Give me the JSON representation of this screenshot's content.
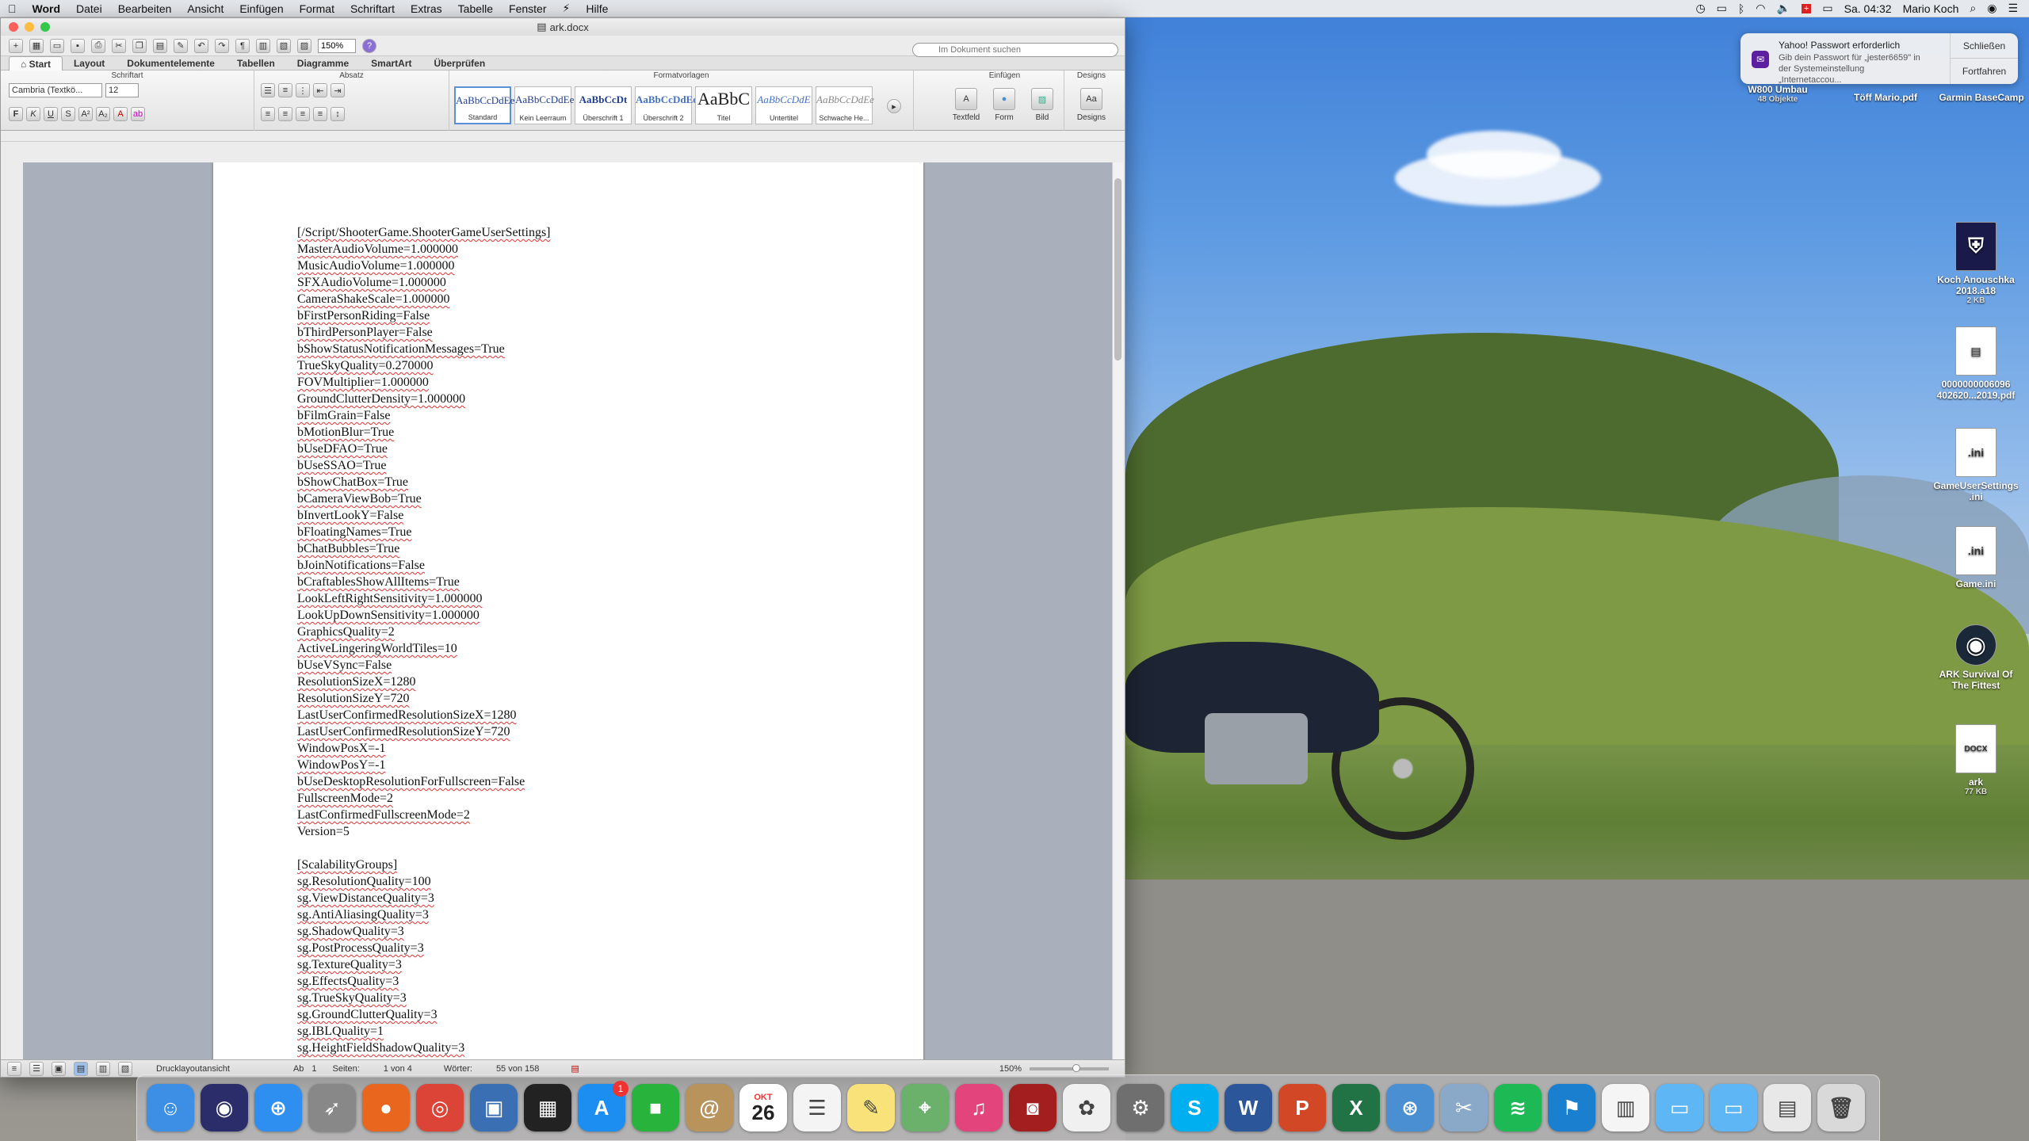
{
  "menubar": {
    "app": "Word",
    "items": [
      "Datei",
      "Bearbeiten",
      "Ansicht",
      "Einfügen",
      "Format",
      "Schriftart",
      "Extras",
      "Tabelle",
      "Fenster",
      "Hilfe"
    ],
    "clock": "Sa. 04:32",
    "user": "Mario Koch"
  },
  "window": {
    "title": "ark.docx",
    "zoom": "150%",
    "search_placeholder": "Im Dokument suchen",
    "tabs": [
      "Start",
      "Layout",
      "Dokumentelemente",
      "Tabellen",
      "Diagramme",
      "SmartArt",
      "Überprüfen"
    ],
    "groups": {
      "font": "Schriftart",
      "paragraph": "Absatz",
      "styles": "Formatvorlagen",
      "insert": "Einfügen",
      "designs": "Designs"
    },
    "font_name": "Cambria (Textkö...",
    "font_size": "12",
    "styles": [
      {
        "preview": "AaBbCcDdEe",
        "name": "Standard"
      },
      {
        "preview": "AaBbCcDdEe",
        "name": "Kein Leerraum"
      },
      {
        "preview": "AaBbCcDt",
        "name": "Überschrift 1"
      },
      {
        "preview": "AaBbCcDdEe",
        "name": "Überschrift 2"
      },
      {
        "preview": "AaBbC",
        "name": "Titel"
      },
      {
        "preview": "AaBbCcDdE",
        "name": "Untertitel"
      },
      {
        "preview": "AaBbCcDdEe",
        "name": "Schwache He..."
      }
    ],
    "insert_items": [
      "Textfeld",
      "Form",
      "Bild"
    ],
    "designs_label": "Designs",
    "status": {
      "view": "Drucklayoutansicht",
      "section_label": "Ab",
      "section": "1",
      "pages_label": "Seiten:",
      "pages": "1 von 4",
      "words_label": "Wörter:",
      "words": "55 von 158",
      "zoom": "150%"
    }
  },
  "document_lines": [
    "[/Script/ShooterGame.ShooterGameUserSettings]",
    "MasterAudioVolume=1.000000",
    "MusicAudioVolume=1.000000",
    "SFXAudioVolume=1.000000",
    "CameraShakeScale=1.000000",
    "bFirstPersonRiding=False",
    "bThirdPersonPlayer=False",
    "bShowStatusNotificationMessages=True",
    "TrueSkyQuality=0.270000",
    "FOVMultiplier=1.000000",
    "GroundClutterDensity=1.000000",
    "bFilmGrain=False",
    "bMotionBlur=True",
    "bUseDFAO=True",
    "bUseSSAO=True",
    "bShowChatBox=True",
    "bCameraViewBob=True",
    "bInvertLookY=False",
    "bFloatingNames=True",
    "bChatBubbles=True",
    "bJoinNotifications=False",
    "bCraftablesShowAllItems=True",
    "LookLeftRightSensitivity=1.000000",
    "LookUpDownSensitivity=1.000000",
    "GraphicsQuality=2",
    "ActiveLingeringWorldTiles=10",
    "bUseVSync=False",
    "ResolutionSizeX=1280",
    "ResolutionSizeY=720",
    "LastUserConfirmedResolutionSizeX=1280",
    "LastUserConfirmedResolutionSizeY=720",
    "WindowPosX=-1",
    "WindowPosY=-1",
    "bUseDesktopResolutionForFullscreen=False",
    "FullscreenMode=2",
    "LastConfirmedFullscreenMode=2",
    "Version=5",
    "",
    "[ScalabilityGroups]",
    "sg.ResolutionQuality=100",
    "sg.ViewDistanceQuality=3",
    "sg.AntiAliasingQuality=3",
    "sg.ShadowQuality=3",
    "sg.PostProcessQuality=3",
    "sg.TextureQuality=3",
    "sg.EffectsQuality=3",
    "sg.TrueSkyQuality=3",
    "sg.GroundClutterQuality=3",
    "sg.IBLQuality=1",
    "sg.HeightFieldShadowQuality=3"
  ],
  "notification": {
    "title": "Yahoo! Passwort erforderlich",
    "body": "Gib dein Passwort für „jester6659\" in der Systemeinstellung „Internetaccou...",
    "close": "Schließen",
    "continue": "Fortfahren"
  },
  "desktop": {
    "top_labels": [
      {
        "name": "W800 Umbau",
        "sub": "48 Objekte"
      },
      {
        "name": "Töff Mario.pdf",
        "sub": ""
      },
      {
        "name": "Garmin BaseCamp",
        "sub": ""
      }
    ],
    "icons": [
      {
        "name": "Koch Anouschka 2018.a18",
        "sub": "2 KB",
        "glyph": "⛨"
      },
      {
        "name": "0000000006096 402620...2019.pdf",
        "sub": "",
        "glyph": "▤"
      },
      {
        "name": "GameUserSettings .ini",
        "sub": "",
        "glyph": ".ini"
      },
      {
        "name": "Game.ini",
        "sub": "",
        "glyph": ".ini"
      },
      {
        "name": "ARK Survival Of The Fittest",
        "sub": "",
        "glyph": "◉"
      },
      {
        "name": "ark",
        "sub": "77 KB",
        "glyph": "DOCX"
      }
    ]
  },
  "dock": {
    "calendar_month": "OKT",
    "calendar_day": "26",
    "appstore_badge": "1",
    "apps": [
      {
        "name": "Finder",
        "glyph": "☺",
        "color": "#3d8fe6"
      },
      {
        "name": "Siri",
        "glyph": "◉",
        "color": "#2b2d6b"
      },
      {
        "name": "Safari",
        "glyph": "⊕",
        "color": "#2f8ff0"
      },
      {
        "name": "Launchpad",
        "glyph": "➶",
        "color": "#888"
      },
      {
        "name": "Firefox",
        "glyph": "●",
        "color": "#e8661d"
      },
      {
        "name": "Chrome",
        "glyph": "◎",
        "color": "#db4437"
      },
      {
        "name": "Preview",
        "glyph": "▣",
        "color": "#3a6fb3"
      },
      {
        "name": "Photo Booth",
        "glyph": "▦",
        "color": "#222"
      },
      {
        "name": "App Store",
        "glyph": "A",
        "color": "#1c8ef2"
      },
      {
        "name": "FaceTime",
        "glyph": "■",
        "color": "#27b33c"
      },
      {
        "name": "Contacts",
        "glyph": "@",
        "color": "#b9935c"
      },
      {
        "name": "Calendar",
        "glyph": "",
        "color": "#ffffff"
      },
      {
        "name": "Reminders",
        "glyph": "☰",
        "color": "#f4f4f4"
      },
      {
        "name": "Notes",
        "glyph": "✎",
        "color": "#f9e27a"
      },
      {
        "name": "Maps",
        "glyph": "⌖",
        "color": "#6bb06b"
      },
      {
        "name": "iTunes",
        "glyph": "♫",
        "color": "#e3447c"
      },
      {
        "name": "Photo Booth 2",
        "glyph": "◙",
        "color": "#a31e1e"
      },
      {
        "name": "Photos",
        "glyph": "✿",
        "color": "#f0f0f0"
      },
      {
        "name": "System Preferences",
        "glyph": "⚙",
        "color": "#6f6f6f"
      },
      {
        "name": "Skype",
        "glyph": "S",
        "color": "#00aff0"
      },
      {
        "name": "Word",
        "glyph": "W",
        "color": "#2b579a"
      },
      {
        "name": "PowerPoint",
        "glyph": "P",
        "color": "#d24726"
      },
      {
        "name": "Excel",
        "glyph": "X",
        "color": "#217346"
      },
      {
        "name": "Network",
        "glyph": "⊛",
        "color": "#4a8fd2"
      },
      {
        "name": "Utility",
        "glyph": "✂",
        "color": "#8aa8c8"
      },
      {
        "name": "Spotify",
        "glyph": "≋",
        "color": "#1db954"
      },
      {
        "name": "Garmin",
        "glyph": "⚑",
        "color": "#1a7fcf"
      },
      {
        "name": "Document",
        "glyph": "▥",
        "color": "#f5f5f5"
      },
      {
        "name": "Folder",
        "glyph": "▭",
        "color": "#5fb6f5"
      },
      {
        "name": "Downloads",
        "glyph": "▭",
        "color": "#5fb6f5"
      },
      {
        "name": "Stack",
        "glyph": "▤",
        "color": "#e8e8e8"
      },
      {
        "name": "Trash",
        "glyph": "🗑",
        "color": "#d9d9d9"
      }
    ]
  }
}
